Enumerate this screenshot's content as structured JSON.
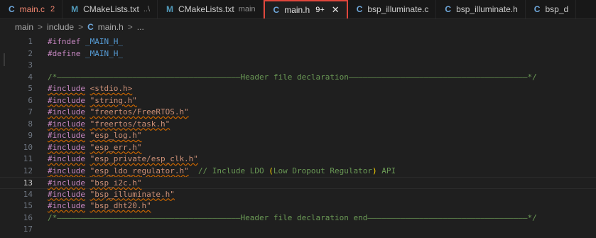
{
  "tabs": [
    {
      "icon": "C",
      "icon_type": "c-file-icon",
      "name": "main.c",
      "badge": "2",
      "desc": "",
      "state": "error"
    },
    {
      "icon": "M",
      "icon_type": "cmake-file-icon",
      "name": "CMakeLists.txt",
      "badge": "",
      "desc": "..\\",
      "state": "normal"
    },
    {
      "icon": "M",
      "icon_type": "cmake-file-icon",
      "name": "CMakeLists.txt",
      "badge": "",
      "desc": "main",
      "state": "normal"
    },
    {
      "icon": "C",
      "icon_type": "c-file-icon",
      "name": "main.h",
      "badge": "9+",
      "desc": "",
      "state": "active"
    },
    {
      "icon": "C",
      "icon_type": "c-file-icon",
      "name": "bsp_illuminate.c",
      "badge": "",
      "desc": "",
      "state": "normal"
    },
    {
      "icon": "C",
      "icon_type": "c-file-icon",
      "name": "bsp_illuminate.h",
      "badge": "",
      "desc": "",
      "state": "normal"
    },
    {
      "icon": "C",
      "icon_type": "c-file-icon",
      "name": "bsp_d",
      "badge": "",
      "desc": "",
      "state": "normal"
    }
  ],
  "close_glyph": "✕",
  "breadcrumb": {
    "items": [
      "main",
      "include",
      "main.h",
      "..."
    ],
    "file_icon": "C",
    "separator": ">"
  },
  "editor": {
    "current_line": 13,
    "lines": [
      {
        "n": "1",
        "parts": [
          [
            "kwd",
            "#ifndef"
          ],
          [
            "",
            " "
          ],
          [
            "mac",
            "_MAIN_H_"
          ]
        ]
      },
      {
        "n": "2",
        "parts": [
          [
            "kwd",
            "#define"
          ],
          [
            "",
            " "
          ],
          [
            "mac",
            "_MAIN_H_"
          ]
        ]
      },
      {
        "n": "3",
        "parts": []
      },
      {
        "n": "4",
        "parts": [
          [
            "cmt",
            "/*———————————————————————————————————————Header file declaration——————————————————————————————————————*/"
          ]
        ]
      },
      {
        "n": "5",
        "parts": [
          [
            "kw",
            "#include"
          ],
          [
            "",
            " "
          ],
          [
            "str",
            "<stdio.h>"
          ]
        ]
      },
      {
        "n": "6",
        "parts": [
          [
            "kw",
            "#include"
          ],
          [
            "",
            " "
          ],
          [
            "str",
            "\"string.h\""
          ]
        ]
      },
      {
        "n": "7",
        "parts": [
          [
            "kw",
            "#include"
          ],
          [
            "",
            " "
          ],
          [
            "str",
            "\"freertos/FreeRTOS.h\""
          ]
        ]
      },
      {
        "n": "8",
        "parts": [
          [
            "kw",
            "#include"
          ],
          [
            "",
            " "
          ],
          [
            "str",
            "\"freertos/task.h\""
          ]
        ]
      },
      {
        "n": "9",
        "parts": [
          [
            "kw",
            "#include"
          ],
          [
            "",
            " "
          ],
          [
            "str",
            "\"esp_log.h\""
          ]
        ]
      },
      {
        "n": "10",
        "parts": [
          [
            "kw",
            "#include"
          ],
          [
            "",
            " "
          ],
          [
            "str",
            "\"esp_err.h\""
          ]
        ]
      },
      {
        "n": "11",
        "parts": [
          [
            "kw",
            "#include"
          ],
          [
            "",
            " "
          ],
          [
            "str",
            "\"esp_private/esp_clk.h\""
          ]
        ]
      },
      {
        "n": "12",
        "parts": [
          [
            "kw",
            "#include"
          ],
          [
            "",
            " "
          ],
          [
            "str",
            "\"esp_ldo_regulator.h\""
          ],
          [
            "",
            "  "
          ],
          [
            "cmt",
            "// Include LDO "
          ],
          [
            "paren",
            "("
          ],
          [
            "cmt",
            "Low Dropout Regulator"
          ],
          [
            "paren",
            ")"
          ],
          [
            "cmt",
            " API"
          ]
        ]
      },
      {
        "n": "13",
        "parts": [
          [
            "kw",
            "#include"
          ],
          [
            "",
            " "
          ],
          [
            "str",
            "\"bsp_i2c.h\""
          ]
        ]
      },
      {
        "n": "14",
        "parts": [
          [
            "kw",
            "#include"
          ],
          [
            "",
            " "
          ],
          [
            "str",
            "\"bsp_illuminate.h\""
          ]
        ]
      },
      {
        "n": "15",
        "parts": [
          [
            "kw",
            "#include"
          ],
          [
            "",
            " "
          ],
          [
            "str",
            "\"bsp_dht20.h\""
          ]
        ]
      },
      {
        "n": "16",
        "parts": [
          [
            "cmt",
            "/*———————————————————————————————————————Header file declaration end——————————————————————————————————*/"
          ]
        ]
      },
      {
        "n": "17",
        "parts": []
      }
    ]
  }
}
